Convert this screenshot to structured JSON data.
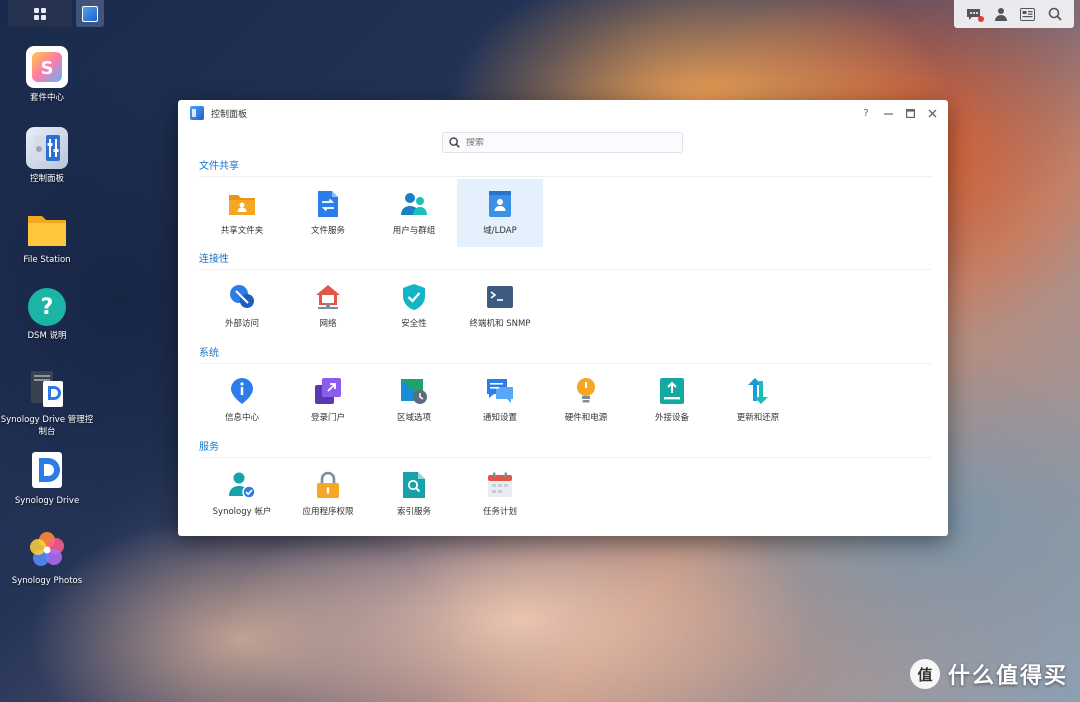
{
  "taskbar": {
    "main_menu_icon": "grid-icon",
    "active_app_icon": "control-panel-icon"
  },
  "tray": {
    "icons": [
      "chat-notification-icon",
      "user-icon",
      "widgets-icon",
      "search-icon"
    ]
  },
  "desktop": {
    "items": [
      {
        "label": "套件中心",
        "icon": "package-center-icon"
      },
      {
        "label": "控制面板",
        "icon": "control-panel-icon"
      },
      {
        "label": "File Station",
        "icon": "folder-icon"
      },
      {
        "label": "DSM 说明",
        "icon": "help-icon"
      },
      {
        "label": "Synology Drive 管理控制台",
        "icon": "drive-admin-icon"
      },
      {
        "label": "Synology Drive",
        "icon": "drive-icon"
      },
      {
        "label": "Synology Photos",
        "icon": "photos-icon"
      }
    ]
  },
  "window": {
    "title": "控制面板",
    "search_placeholder": "搜索",
    "sections": [
      {
        "title": "文件共享",
        "items": [
          {
            "label": "共享文件夹",
            "icon": "shared-folder-icon",
            "color": "#f5a623"
          },
          {
            "label": "文件服务",
            "icon": "file-services-icon",
            "color": "#2b7de9"
          },
          {
            "label": "用户与群组",
            "icon": "users-groups-icon",
            "color": "#1a9bd7"
          },
          {
            "label": "域/LDAP",
            "icon": "ldap-icon",
            "color": "#3b8fe6",
            "selected": true
          }
        ]
      },
      {
        "title": "连接性",
        "items": [
          {
            "label": "外部访问",
            "icon": "external-access-icon",
            "color": "#2b7de9"
          },
          {
            "label": "网络",
            "icon": "network-icon",
            "color": "#e0574a"
          },
          {
            "label": "安全性",
            "icon": "security-icon",
            "color": "#12b5c4"
          },
          {
            "label": "终端机和 SNMP",
            "icon": "terminal-icon",
            "color": "#3d5a80"
          }
        ]
      },
      {
        "title": "系统",
        "items": [
          {
            "label": "信息中心",
            "icon": "info-center-icon",
            "color": "#2b7de9"
          },
          {
            "label": "登录门户",
            "icon": "login-portal-icon",
            "color": "#7d4fd6"
          },
          {
            "label": "区域选项",
            "icon": "regional-options-icon",
            "color": "#20a36b"
          },
          {
            "label": "通知设置",
            "icon": "notification-icon",
            "color": "#2b7de9"
          },
          {
            "label": "硬件和电源",
            "icon": "hardware-power-icon",
            "color": "#f5a623"
          },
          {
            "label": "外接设备",
            "icon": "external-devices-icon",
            "color": "#13a8a0"
          },
          {
            "label": "更新和还原",
            "icon": "update-restore-icon",
            "color": "#1a9bd7"
          }
        ]
      },
      {
        "title": "服务",
        "items": [
          {
            "label": "Synology 帐户",
            "icon": "synology-account-icon",
            "color": "#17a2a8"
          },
          {
            "label": "应用程序权限",
            "icon": "app-privileges-icon",
            "color": "#f5a623"
          },
          {
            "label": "索引服务",
            "icon": "indexing-service-icon",
            "color": "#17a2a8"
          },
          {
            "label": "任务计划",
            "icon": "task-scheduler-icon",
            "color": "#e0574a"
          }
        ]
      }
    ]
  },
  "watermark": {
    "symbol": "值",
    "text": "什么值得买"
  }
}
